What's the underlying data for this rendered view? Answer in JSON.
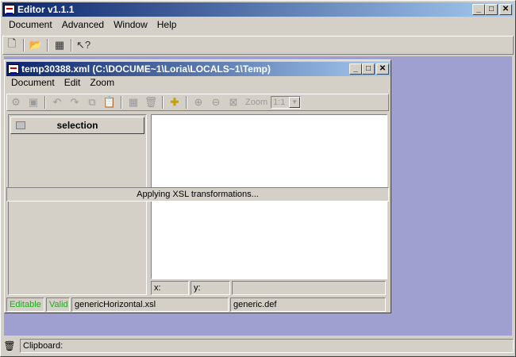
{
  "app": {
    "title": "Editor v1.1.1",
    "menu": [
      {
        "label": "Document",
        "key": "D"
      },
      {
        "label": "Advanced",
        "key": "A"
      },
      {
        "label": "Window",
        "key": "W"
      },
      {
        "label": "Help",
        "key": "H"
      }
    ]
  },
  "inner": {
    "title": "temp30388.xml  (C:\\DOCUME~1\\Loria\\LOCALS~1\\Temp)",
    "menu": [
      {
        "label": "Document",
        "key": "D"
      },
      {
        "label": "Edit",
        "key": "E"
      },
      {
        "label": "Zoom",
        "key": "Z"
      }
    ],
    "zoom_label": "Zoom",
    "zoom_value": "1:1",
    "selection_label": "selection",
    "progress_text": "Applying XSL transformations...",
    "coord_x": "x:",
    "coord_y": "y:",
    "status": {
      "editable": "Editable",
      "valid": "Valid",
      "xsl": "genericHorizontal.xsl",
      "def": "generic.def"
    }
  },
  "clipboard": {
    "label": "Clipboard:"
  },
  "colors": {
    "desktop": "#a0a0d0",
    "titlebar": "#0a246a",
    "status_green": "#22aa22"
  }
}
